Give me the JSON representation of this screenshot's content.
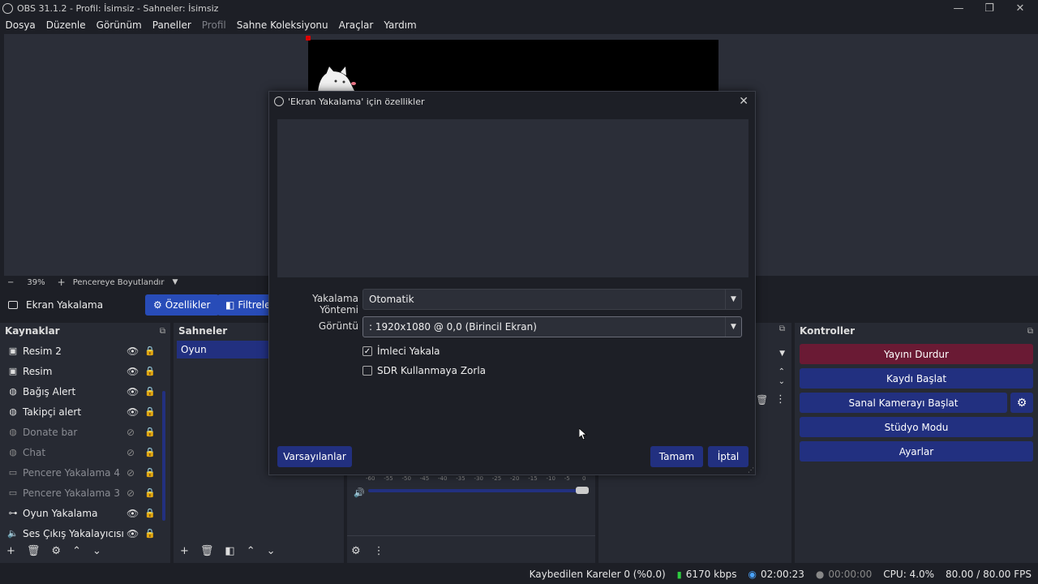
{
  "window": {
    "title": "OBS 31.1.2 - Profil: İsimsiz - Sahneler: İsimsiz"
  },
  "menu": [
    "Dosya",
    "Düzenle",
    "Görünüm",
    "Paneller",
    "Profil",
    "Sahne Koleksiyonu",
    "Araçlar",
    "Yardım"
  ],
  "zoom": {
    "minus": "−",
    "value": "39%",
    "plus": "+",
    "fit_label": "Pencereye Boyutlandır"
  },
  "context": {
    "source_name": "Ekran Yakalama",
    "properties": "Özellikler",
    "filters": "Filtreler"
  },
  "sources": {
    "title": "Kaynaklar",
    "items": [
      {
        "label": "Resim 2",
        "icon": "image-icon",
        "visible": true
      },
      {
        "label": "Resim",
        "icon": "image-icon",
        "visible": true
      },
      {
        "label": "Bağış Alert",
        "icon": "globe-icon",
        "visible": true
      },
      {
        "label": "Takipçi alert",
        "icon": "globe-icon",
        "visible": true
      },
      {
        "label": "Donate bar",
        "icon": "globe-icon",
        "visible": false
      },
      {
        "label": "Chat",
        "icon": "globe-icon",
        "visible": false
      },
      {
        "label": "Pencere Yakalama 4",
        "icon": "window-icon",
        "visible": false
      },
      {
        "label": "Pencere Yakalama 3",
        "icon": "window-icon",
        "visible": false
      },
      {
        "label": "Oyun Yakalama",
        "icon": "gamepad-icon",
        "visible": true
      },
      {
        "label": "Ses Çıkış Yakalayıcısı",
        "icon": "speaker-icon",
        "visible": true
      }
    ]
  },
  "scenes": {
    "title": "Sahneler",
    "items": [
      "Oyun"
    ]
  },
  "controls": {
    "title": "Kontroller",
    "stop_stream": "Yayını Durdur",
    "start_record": "Kaydı Başlat",
    "virtual_cam": "Sanal Kamerayı Başlat",
    "studio_mode": "Stüdyo Modu",
    "settings": "Ayarlar"
  },
  "mixer": {
    "ticks": [
      "-60",
      "-55",
      "-50",
      "-45",
      "-40",
      "-35",
      "-30",
      "-25",
      "-20",
      "-15",
      "-10",
      "-5",
      "0"
    ]
  },
  "status": {
    "dropped": "Kaybedilen Kareler 0 (%0.0)",
    "bitrate": "6170 kbps",
    "stream_time": "02:00:23",
    "record_time": "00:00:00",
    "cpu": "CPU: 4.0%",
    "fps": "80.00 / 80.00 FPS"
  },
  "dialog": {
    "title": "'Ekran Yakalama' için özellikler",
    "method_label": "Yakalama Yöntemi",
    "method_value": "Otomatik",
    "display_label": "Görüntü",
    "display_value": ": 1920x1080 @ 0,0 (Birincil Ekran)",
    "capture_cursor": "İmleci Yakala",
    "capture_cursor_checked": true,
    "force_sdr": "SDR Kullanmaya Zorla",
    "force_sdr_checked": false,
    "defaults": "Varsayılanlar",
    "ok": "Tamam",
    "cancel": "İptal"
  },
  "colors": {
    "accent": "#223080",
    "stop": "#6a1a34",
    "panel": "#272a33",
    "bg": "#1d1f26"
  }
}
